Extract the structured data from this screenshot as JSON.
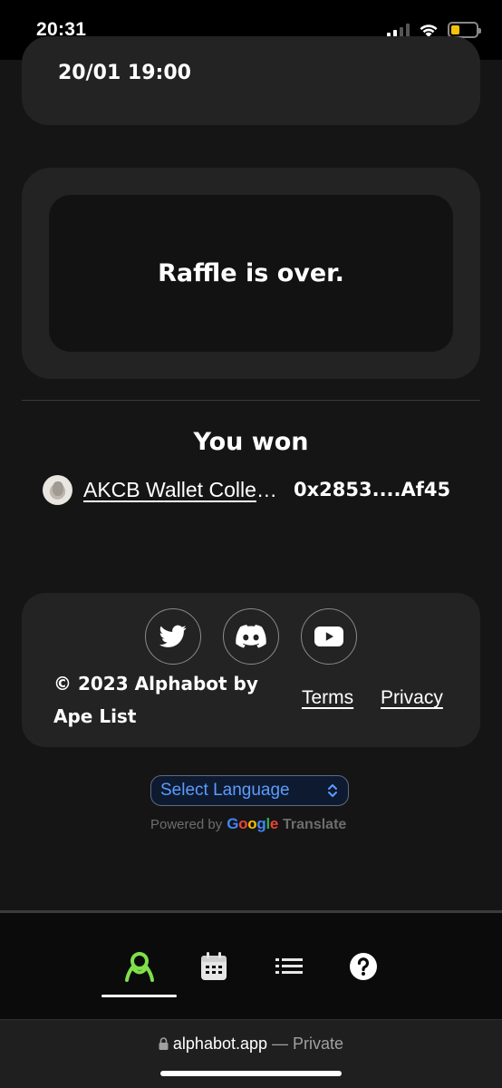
{
  "status_bar": {
    "time": "20:31"
  },
  "event": {
    "date": "20/01 19:00"
  },
  "raffle": {
    "status_text": "Raffle is over."
  },
  "winners": {
    "title": "You won",
    "entries": [
      {
        "project": "AKCB Wallet Collection",
        "wallet": "0x2853....Af45"
      }
    ]
  },
  "footer": {
    "social": [
      "twitter-icon",
      "discord-icon",
      "youtube-icon"
    ],
    "copyright": "© 2023 Alphabot by Ape List",
    "links": {
      "terms": "Terms",
      "privacy": "Privacy"
    }
  },
  "translate": {
    "select_label": "Select Language",
    "powered_by": "Powered by",
    "google": [
      "G",
      "o",
      "o",
      "g",
      "l",
      "e"
    ],
    "translate_word": "Translate"
  },
  "bottom_nav": {
    "items": [
      "alphabot-logo-icon",
      "calendar-icon",
      "list-icon",
      "help-icon"
    ],
    "active_index": 0,
    "accent_color": "#7ee04a"
  },
  "browser": {
    "domain": "alphabot.app",
    "separator": "—",
    "mode": "Private"
  }
}
